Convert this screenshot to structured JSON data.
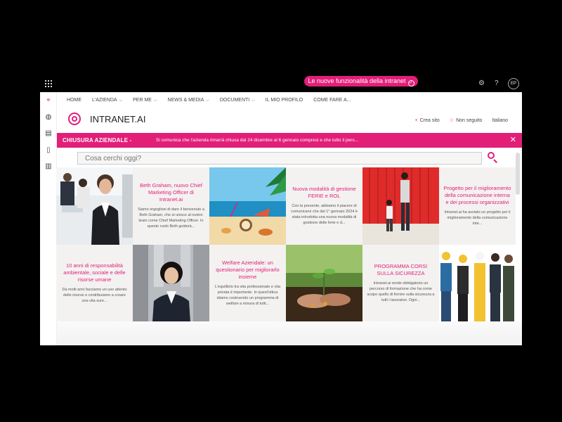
{
  "suite_bar": {
    "promo": "Le nuove funzionalità della intranet",
    "promo_icon": "check-circle-icon",
    "settings_icon": "gear-icon",
    "help_label": "?",
    "avatar_initials": "EP"
  },
  "left_rail": [
    "home-icon",
    "globe-icon",
    "newsfeed-icon",
    "document-icon",
    "library-icon"
  ],
  "nav": [
    {
      "label": "HOME",
      "dropdown": false
    },
    {
      "label": "L'AZIENDA",
      "dropdown": true
    },
    {
      "label": "PER ME",
      "dropdown": true
    },
    {
      "label": "NEWS & MEDIA",
      "dropdown": true
    },
    {
      "label": "DOCUMENTI",
      "dropdown": true
    },
    {
      "label": "IL MIO PROFILO",
      "dropdown": false
    },
    {
      "label": "COME FARE A...",
      "dropdown": false
    }
  ],
  "site": {
    "title": "INTRANET.AI",
    "create_site": "Crea sito",
    "following": "Non seguito",
    "language": "Italiano"
  },
  "ticker": {
    "title": "CHIUSURA AZIENDALE -",
    "text": "Si comunica che l'azienda rimarrà chiusa dal 24 dicembre al 6 gennaio compresi e che tutto il pers..."
  },
  "search": {
    "placeholder": "Cosa cerchi oggi?"
  },
  "tiles": [
    {
      "kind": "photo",
      "subject": "office-team"
    },
    {
      "kind": "text",
      "title": "Beth Graham, nuovo Chief Marketing Officer di Intranet.ai",
      "desc": "Siamo orgogliosi di dare il benvenuto a Beth Graham, che si unisce al nostro team come Chief Marketing Officer. In questo ruolo Beth guiderà..."
    },
    {
      "kind": "photo",
      "subject": "beach"
    },
    {
      "kind": "text",
      "title": "Nuova modalità di gestione FERIE e ROL",
      "desc": "Con la presente, abbiamo il piacere di comunicarvi che dal 1° gennaio 2024 è stata introdotta una nuova modalità di gestione delle ferie e d..."
    },
    {
      "kind": "photo",
      "subject": "red-door-family"
    },
    {
      "kind": "text",
      "title": "Progetto per il miglioramento della comunicazione interna e dei processi organizzativi",
      "desc": "Intranet.ai ha avviato un progetto per il miglioramento della comunicazione inte..."
    },
    {
      "kind": "text",
      "title": "10 anni di responsabilità ambientale, sociale e delle risorse umane",
      "desc": "Da molti anni facciamo un uso attento delle risorse e contribuiamo a creare una vita sure..."
    },
    {
      "kind": "photo",
      "subject": "businesswoman"
    },
    {
      "kind": "text",
      "title": "Welfare Aziendale: un questionario per migliorarlo insieme",
      "desc": "L'equilibrio tra vita professionale e vita privata è importante. In quest'ottica stiamo costruendo un programma di welfare a misura di tutti..."
    },
    {
      "kind": "photo",
      "subject": "plant-hands"
    },
    {
      "kind": "text",
      "title": "PROGRAMMA CORSI SULLA SICUREZZA",
      "desc": "Intranet.ai rende obbligatorio un percorso di formazione che ha come scopo quello di fornire sulla sicurezza a tutti i lavoratori. Ogni..."
    },
    {
      "kind": "photo",
      "subject": "workers"
    }
  ],
  "colors": {
    "accent": "#e31e79",
    "background": "#000000",
    "page": "#ffffff",
    "tile_bg": "#f3f2f1"
  }
}
